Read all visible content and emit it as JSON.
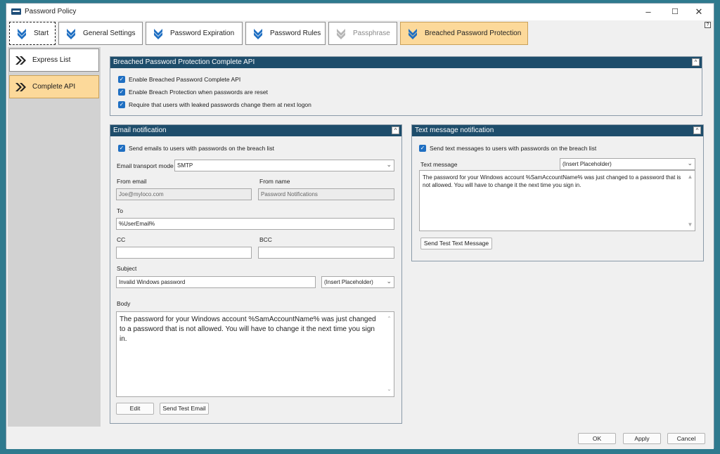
{
  "window": {
    "title": "Password Policy",
    "help_label": "?"
  },
  "tabs": [
    {
      "label": "Start"
    },
    {
      "label": "General Settings"
    },
    {
      "label": "Password Expiration"
    },
    {
      "label": "Password Rules"
    },
    {
      "label": "Passphrase"
    },
    {
      "label": "Breached Password Protection"
    }
  ],
  "sidebar": {
    "items": [
      {
        "label": "Express List"
      },
      {
        "label": "Complete API"
      }
    ]
  },
  "api_panel": {
    "title": "Breached Password Protection Complete API",
    "collapse_label": "^",
    "options": [
      "Enable Breached Password Complete API",
      "Enable Breach Protection when passwords are reset",
      "Require that users with leaked passwords change them at next logon"
    ]
  },
  "email": {
    "title": "Email notification",
    "collapse_label": "^",
    "send_check": "Send emails to users with passwords on the breach list",
    "transport_label": "Email transport mode",
    "transport_value": "SMTP",
    "from_email_label": "From email",
    "from_email_value": "Joe@myloco.com",
    "from_name_label": "From name",
    "from_name_value": "Password Notifications",
    "to_label": "To",
    "to_value": "%UserEmail%",
    "cc_label": "CC",
    "cc_value": "",
    "bcc_label": "BCC",
    "bcc_value": "",
    "subject_label": "Subject",
    "subject_value": "Invalid Windows password",
    "placeholder_select": "(Insert Placeholder)",
    "body_label": "Body",
    "body_text": "The password for your Windows account %SamAccountName% was just changed to a password that is not allowed. You will have to change it the next time you sign in.",
    "edit_button": "Edit",
    "send_test_button": "Send Test Email"
  },
  "sms": {
    "title": "Text message notification",
    "collapse_label": "^",
    "send_check": "Send text messages to users with passwords on the breach list",
    "message_label": "Text message",
    "placeholder_select": "(Insert Placeholder)",
    "message_text": "The password for your Windows account %SamAccountName% was just changed to a password that is not allowed. You will have to change it the next time you sign in.",
    "send_test_button": "Send Test Text Message"
  },
  "footer": {
    "ok": "OK",
    "apply": "Apply",
    "cancel": "Cancel"
  },
  "colors": {
    "accent_tab": "#fcd99a",
    "panel_header": "#1e4d6b",
    "checkbox": "#1f6fc2",
    "chevron_blue": "#1f6fc2"
  }
}
